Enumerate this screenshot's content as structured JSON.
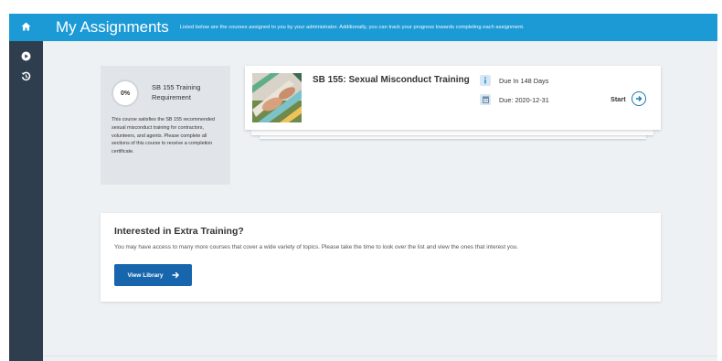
{
  "sidebar": {
    "items": [
      {
        "icon": "home-icon"
      },
      {
        "icon": "play-circle-icon"
      },
      {
        "icon": "history-icon"
      }
    ]
  },
  "header": {
    "title": "My Assignments",
    "subtitle": "Listed below are the courses assigned to you by your administrator. Additionally, you can track your progress towards completing each assignment."
  },
  "summary": {
    "progress": "0%",
    "progress_value": 0,
    "title": "SB 155 Training Requirement",
    "description": "This course satisfies the SB 155 recommended sexual misconduct training for contractors, volunteers, and agents. Please complete all sections of this course to receive a completion certificate."
  },
  "course": {
    "title": "SB 155: Sexual Misconduct Training",
    "due_in": "Due In 148 Days",
    "due_date": "Due: 2020-12-31",
    "start_label": "Start"
  },
  "extra": {
    "title": "Interested in Extra Training?",
    "description": "You may have access to many more courses that cover a wide variety of topics. Please take the time to look over the list and view the ones that interest you.",
    "button_label": "View Library"
  },
  "colors": {
    "accent": "#1c9ad6",
    "sidebar": "#2e3e4f",
    "button": "#1766ad",
    "background": "#eef1f4"
  }
}
